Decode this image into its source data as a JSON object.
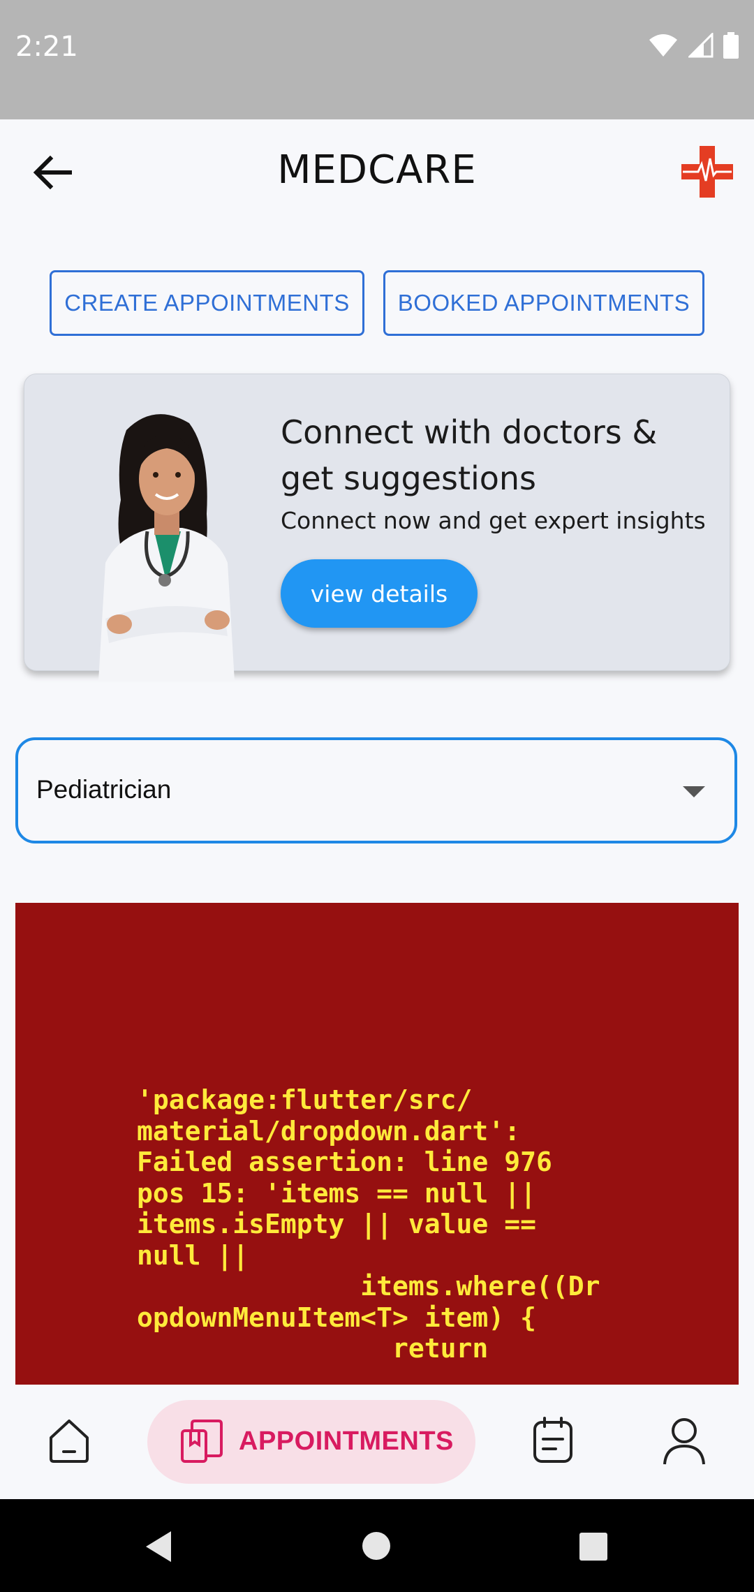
{
  "status_bar": {
    "time": "2:21"
  },
  "app_bar": {
    "title": "MEDCARE"
  },
  "tabs": {
    "create": "CREATE APPOINTMENTS",
    "booked": "BOOKED APPOINTMENTS"
  },
  "promo": {
    "title": "Connect with doctors & get suggestions",
    "subtitle": "Connect now and get expert insights",
    "button": "view details"
  },
  "specialty": {
    "selected": "Pediatrician"
  },
  "error": {
    "message": "'package:flutter/src/\nmaterial/dropdown.dart':\nFailed assertion: line 976\npos 15: 'items == null ||\nitems.isEmpty || value ==\nnull ||\n              items.where((Dr\nopdownMenuItem<T> item) {\n                return"
  },
  "bottom_nav": {
    "active_label": "APPOINTMENTS"
  },
  "colors": {
    "accent": "#2f6fd6",
    "primary_button": "#2196f3",
    "error_bg": "#961010",
    "error_text": "#ffea3b",
    "nav_active": "#d81b60"
  }
}
